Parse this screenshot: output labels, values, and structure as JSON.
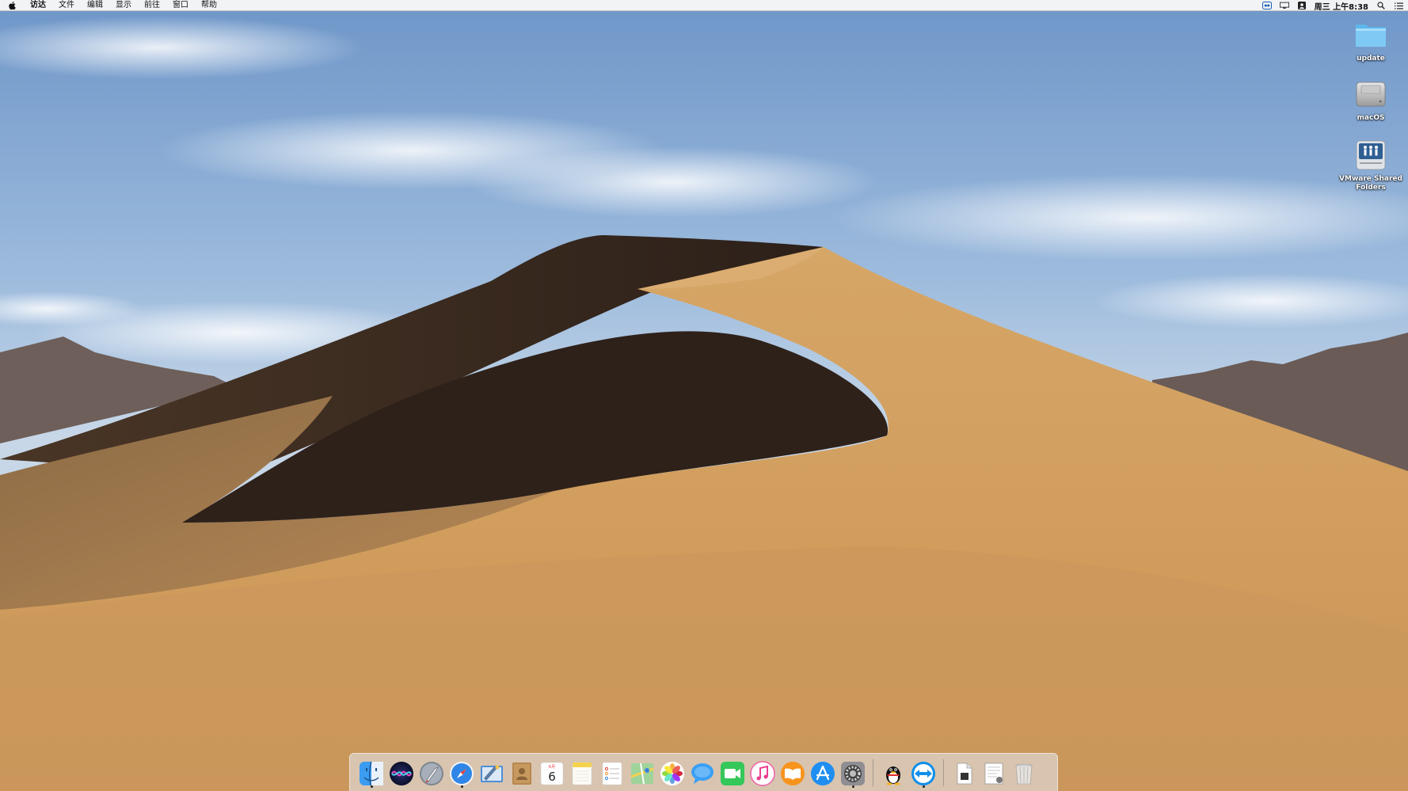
{
  "menubar": {
    "apple_icon": "apple-logo-icon",
    "items": [
      "访达",
      "文件",
      "编辑",
      "显示",
      "前往",
      "窗口",
      "帮助"
    ],
    "clock": "周三 上午8:38",
    "status_icons": [
      "teamviewer-icon",
      "display-icon",
      "user-icon",
      "search-icon",
      "list-icon"
    ]
  },
  "desktop_icons": [
    {
      "label": "update",
      "icon": "folder-icon"
    },
    {
      "label": "macOS",
      "icon": "hard-drive-icon"
    },
    {
      "label": "VMware Shared Folders",
      "icon": "shared-folder-icon"
    }
  ],
  "dock": {
    "calendar": {
      "month": "6月",
      "day": "6"
    },
    "apps": [
      "finder",
      "siri",
      "launchpad",
      "safari",
      "mail",
      "contacts",
      "calendar",
      "notes",
      "reminders",
      "maps",
      "photos",
      "messages",
      "facetime",
      "itunes",
      "books",
      "app-store",
      "system-preferences",
      "qq",
      "teamviewer",
      "document",
      "preview",
      "trash"
    ]
  },
  "colors": {
    "sky_top": "#6f97c9",
    "sand_light": "#d9a865",
    "sand_shadow": "#3a2a1e",
    "mountain": "#6e5f5a"
  }
}
